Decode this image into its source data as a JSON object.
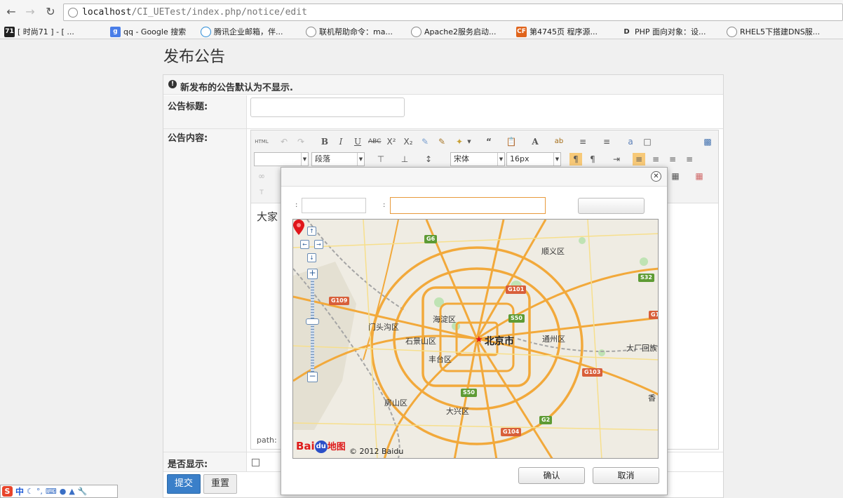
{
  "browser": {
    "url_prefix": "localhost",
    "url_path": "/CI_UETest/index.php/notice/edit",
    "bookmarks": [
      {
        "icon": "71",
        "label": "[ 时尚71 ] - [ ...",
        "color": "#222222"
      },
      {
        "icon": "g",
        "label": "qq - Google 搜索",
        "color": "#4a7ee8"
      },
      {
        "icon": "tencent-icon",
        "label": "腾讯企业邮箱，伴...",
        "color": "#2b8cd8"
      },
      {
        "icon": "globe-icon",
        "label": "联机帮助命令：ma...",
        "color": "#888888"
      },
      {
        "icon": "globe-icon",
        "label": "Apache2服务启动...",
        "color": "#888888"
      },
      {
        "icon": "CF",
        "label": "第4745页 程序源...",
        "color": "#e0641c"
      },
      {
        "icon": "PHP",
        "label": "PHP 面向对象：设...",
        "color": "#333333"
      },
      {
        "icon": "globe-icon",
        "label": "RHEL5下搭建DNS服...",
        "color": "#888888"
      }
    ]
  },
  "page": {
    "title": "发布公告",
    "notice": "新发布的公告默认为不显示.",
    "label_title": "公告标题:",
    "label_content": "公告内容:",
    "label_show": "是否显示:",
    "submit": "提交",
    "reset": "重置"
  },
  "editor": {
    "html_btn": "HTML",
    "paragraph_select": "段落",
    "font_select": "宋体",
    "size_select": "16px",
    "content_preview": "大家",
    "path_label": "path:"
  },
  "dialog": {
    "confirm": "确认",
    "cancel": "取消",
    "map_labels": {
      "shunyi": "顺义区",
      "haidian": "海淀区",
      "mentougou": "门头沟区",
      "shijingshan": "石景山区",
      "beijing": "北京市",
      "tongzhou": "通州区",
      "fengtai": "丰台区",
      "fangshan": "房山区",
      "daxing": "大兴区",
      "dachang": "大厂回族",
      "xiang": "香"
    },
    "shields": [
      "G6",
      "G101",
      "G109",
      "S50",
      "S32",
      "G103",
      "S50",
      "G104",
      "G2",
      "G1"
    ],
    "logo": {
      "bai": "Bai",
      "paw": "du",
      "word": "地图"
    },
    "copyright": "© 2012 Baidu"
  },
  "ime": {
    "lang": "中"
  },
  "colors": {
    "accent": "#3a7fc9",
    "map_road": "#f2a93b",
    "pin": "#e0161b"
  }
}
